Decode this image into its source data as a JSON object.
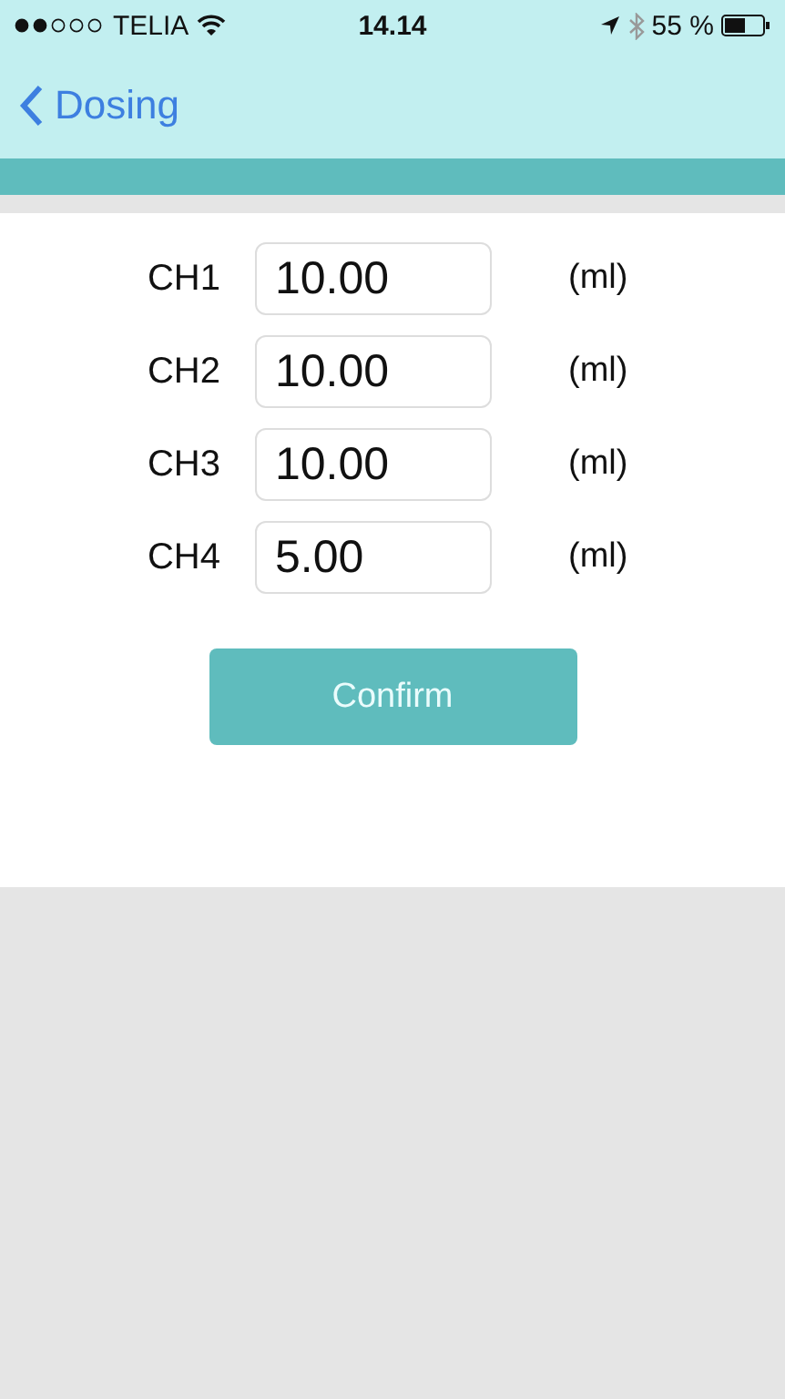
{
  "status_bar": {
    "carrier": "TELIA",
    "time": "14.14",
    "battery": "55 %"
  },
  "nav": {
    "back": "Dosing"
  },
  "channels": [
    {
      "label": "CH1",
      "value": "10.00",
      "unit": "(ml)"
    },
    {
      "label": "CH2",
      "value": "10.00",
      "unit": "(ml)"
    },
    {
      "label": "CH3",
      "value": "10.00",
      "unit": "(ml)"
    },
    {
      "label": "CH4",
      "value": "5.00",
      "unit": "(ml)"
    }
  ],
  "confirm": "Confirm"
}
